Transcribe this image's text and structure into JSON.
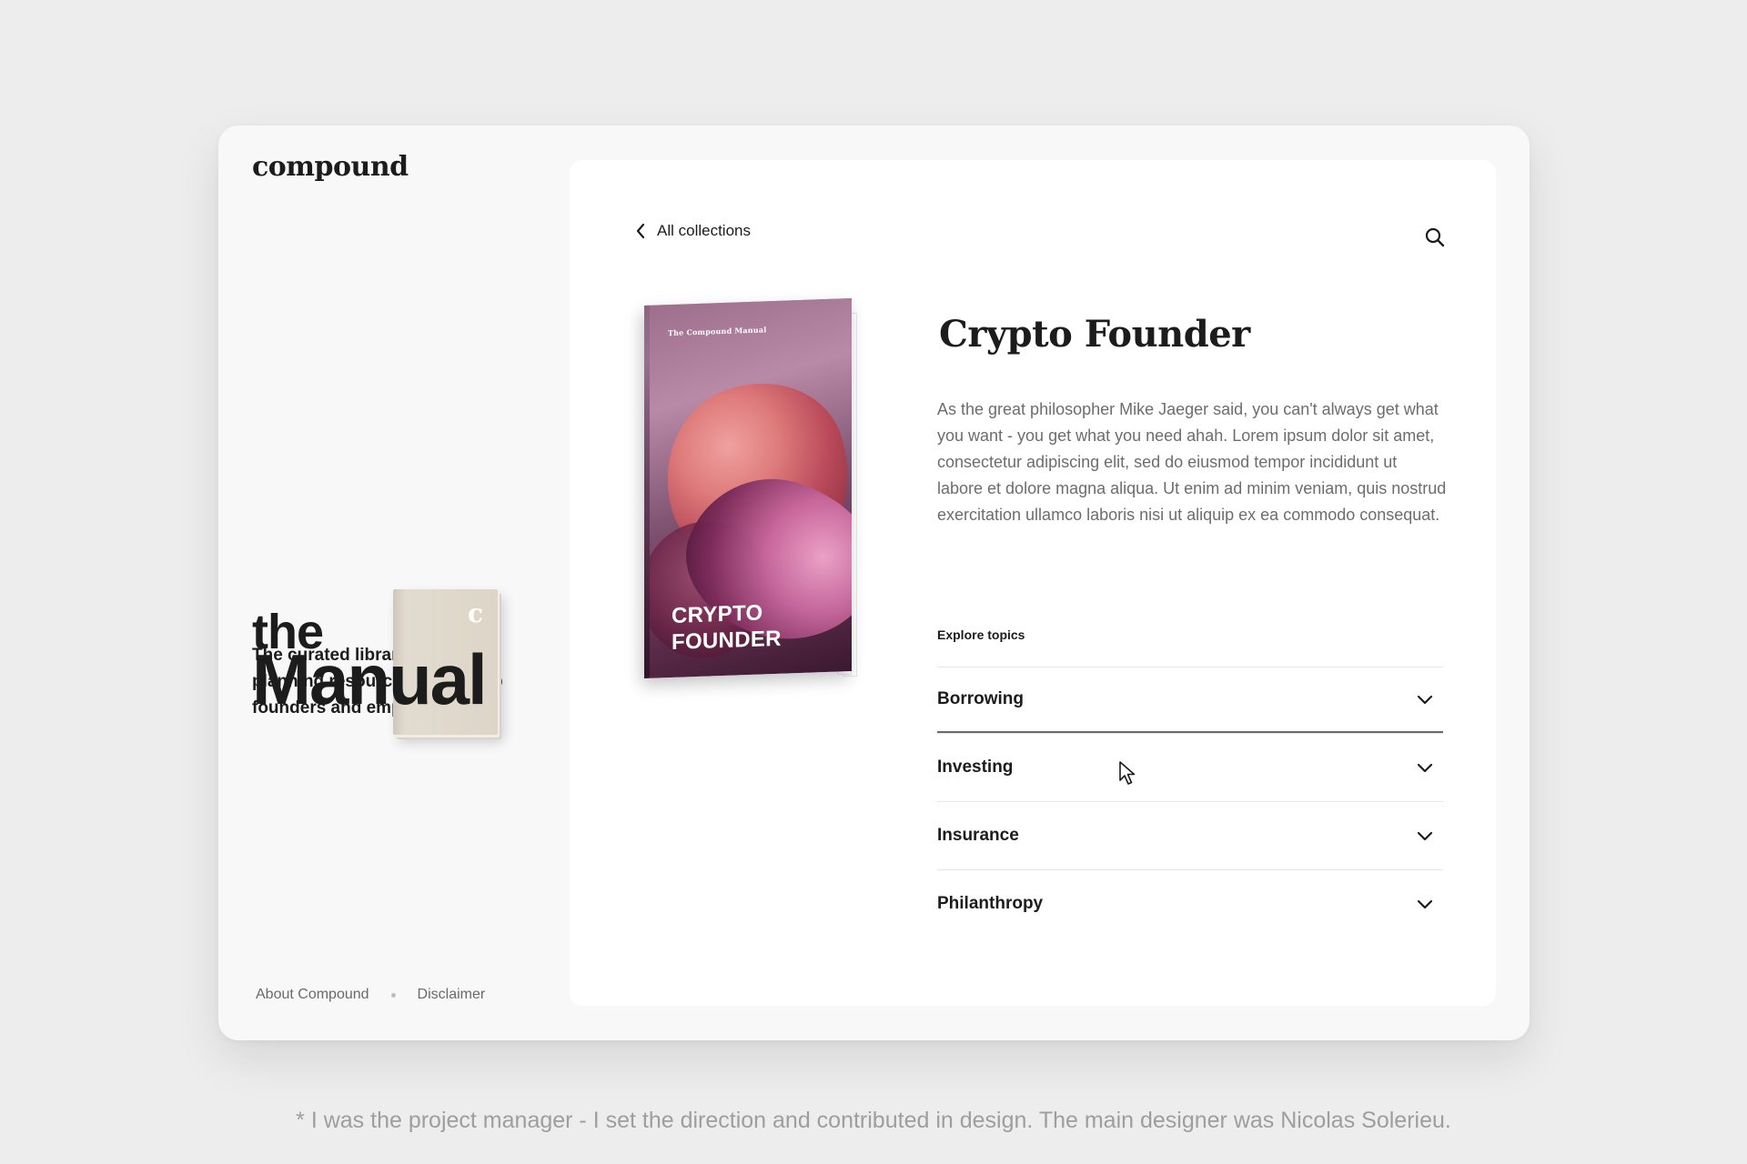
{
  "brand": {
    "logo_text": "compound"
  },
  "hero": {
    "the": "the",
    "manual": "Manual",
    "book_mark": "c",
    "tagline": "The curated library of wealth planning resources for startup founders and employees."
  },
  "footer": {
    "about_label": "About Compound",
    "disclaimer_label": "Disclaimer"
  },
  "nav": {
    "back_label": "All collections",
    "back_icon": "chevron-left-icon",
    "search_icon": "search-icon"
  },
  "collection": {
    "cover_small_text": "The Compound Manual",
    "cover_title": "CRYPTO FOUNDER",
    "title": "Crypto Founder",
    "description": "As the great philosopher Mike Jaeger said, you can't always get what you want - you get what you need ahah. Lorem ipsum dolor sit amet, consectetur adipiscing elit, sed do eiusmod tempor incididunt ut labore et dolore magna aliqua. Ut enim ad minim veniam, quis nostrud exercitation ullamco laboris nisi ut aliquip ex ea commodo consequat."
  },
  "topics": {
    "heading": "Explore topics",
    "items": [
      {
        "label": "Borrowing",
        "icon": "chevron-down-icon"
      },
      {
        "label": "Investing",
        "icon": "chevron-down-icon"
      },
      {
        "label": "Insurance",
        "icon": "chevron-down-icon"
      },
      {
        "label": "Philanthropy",
        "icon": "chevron-down-icon"
      }
    ]
  },
  "caption": "* I was the project manager - I set the direction and contributed in design. The main designer was Nicolas Solerieu.",
  "colors": {
    "background": "#ededed",
    "frame": "#f8f8f8",
    "panel": "#ffffff",
    "text": "#1c1c1c",
    "muted": "#6d6d6d",
    "cover_primary": "#7a4e6c"
  }
}
